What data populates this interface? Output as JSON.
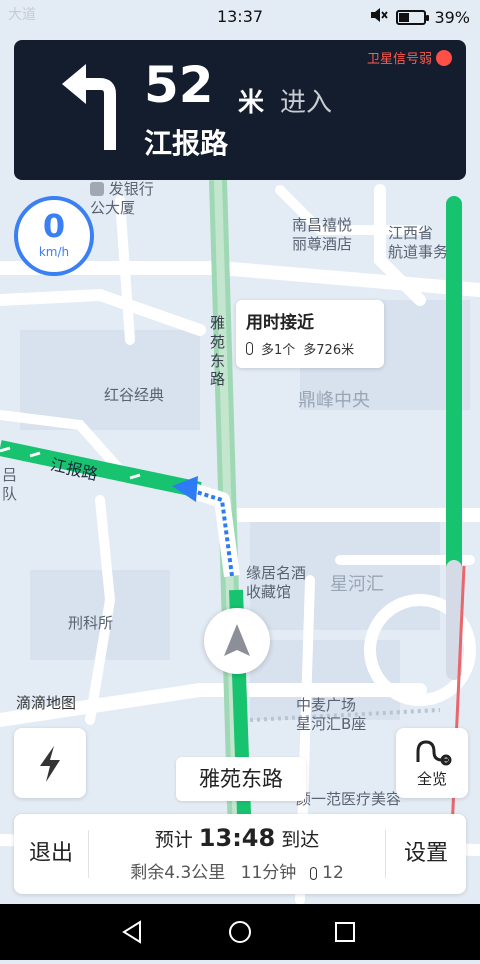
{
  "status_bar": {
    "time": "13:37",
    "battery": "39%",
    "battery_level": 0.39,
    "ghost_text": "大道"
  },
  "nav_banner": {
    "distance": "52",
    "unit": "米",
    "action": "进入",
    "road": "江报路",
    "gps_status": "卫星信号弱"
  },
  "speed": {
    "value": "0",
    "unit": "km/h"
  },
  "tip_card": {
    "title": "用时接近",
    "lights": "多1个",
    "distance": "多726米"
  },
  "map_labels": {
    "bank": "发银行\n公大厦",
    "hotel": "南昌禧悦\n丽尊酒店",
    "province": "江西省\n航道事务",
    "yayuan_vertical": "雅苑东路",
    "honggu": "红谷经典",
    "dingfeng": "鼎峰中央",
    "jiangbao": "江报路",
    "left_edge": "吕\n队",
    "luju": "缘居名酒\n收藏馆",
    "xinghe": "星河汇",
    "xingke": "刑科所",
    "didi": "滴滴地图",
    "zhongmai": "中麦广场\n星河汇B座",
    "yiyifan": "颜一范医疗美容"
  },
  "current_road": "雅苑东路",
  "overview_label": "全览",
  "bottom_panel": {
    "exit": "退出",
    "eta_prefix": "预计",
    "eta_time": "13:48",
    "eta_suffix": "到达",
    "remaining": "剩余4.3公里",
    "duration": "11分钟",
    "lights": "12",
    "settings": "设置"
  },
  "colors": {
    "banner_bg": "#141d2d",
    "route_green": "#17c36e",
    "speed_blue": "#3b7ff4",
    "warning_red": "#ff4f47",
    "map_bg": "#e3ebf5"
  }
}
